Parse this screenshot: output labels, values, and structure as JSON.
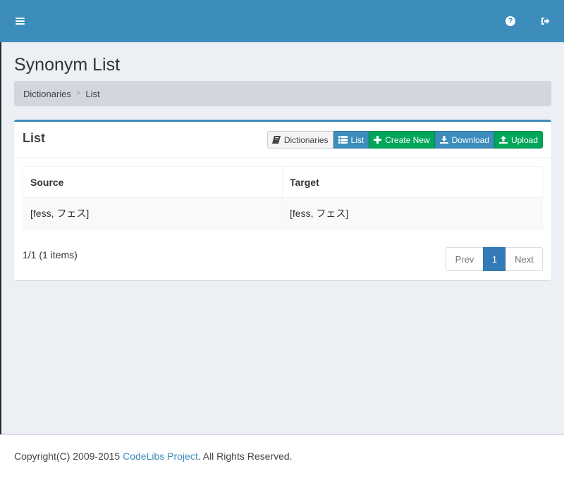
{
  "header": {
    "menu_icon": "hamburger-icon",
    "help_icon": "question-circle-icon",
    "logout_icon": "sign-out-icon",
    "color": "#3c8dbc"
  },
  "page": {
    "title": "Synonym List"
  },
  "breadcrumb": {
    "items": [
      "Dictionaries",
      "List"
    ],
    "separator": ">"
  },
  "box": {
    "title": "List",
    "buttons": {
      "dictionaries": "Dictionaries",
      "list": "List",
      "create_new": "Create New",
      "download": "Download",
      "upload": "Upload"
    },
    "table": {
      "headers": [
        "Source",
        "Target"
      ],
      "rows": [
        [
          "[fess, フェス]",
          "[fess, フェス]"
        ]
      ]
    },
    "count_text": "1/1 (1 items)",
    "pagination": {
      "prev": "Prev",
      "current": "1",
      "next": "Next"
    }
  },
  "footer": {
    "prefix": "Copyright(C) 2009-2015 ",
    "link": "CodeLibs Project",
    "suffix": ". All Rights Reserved."
  }
}
